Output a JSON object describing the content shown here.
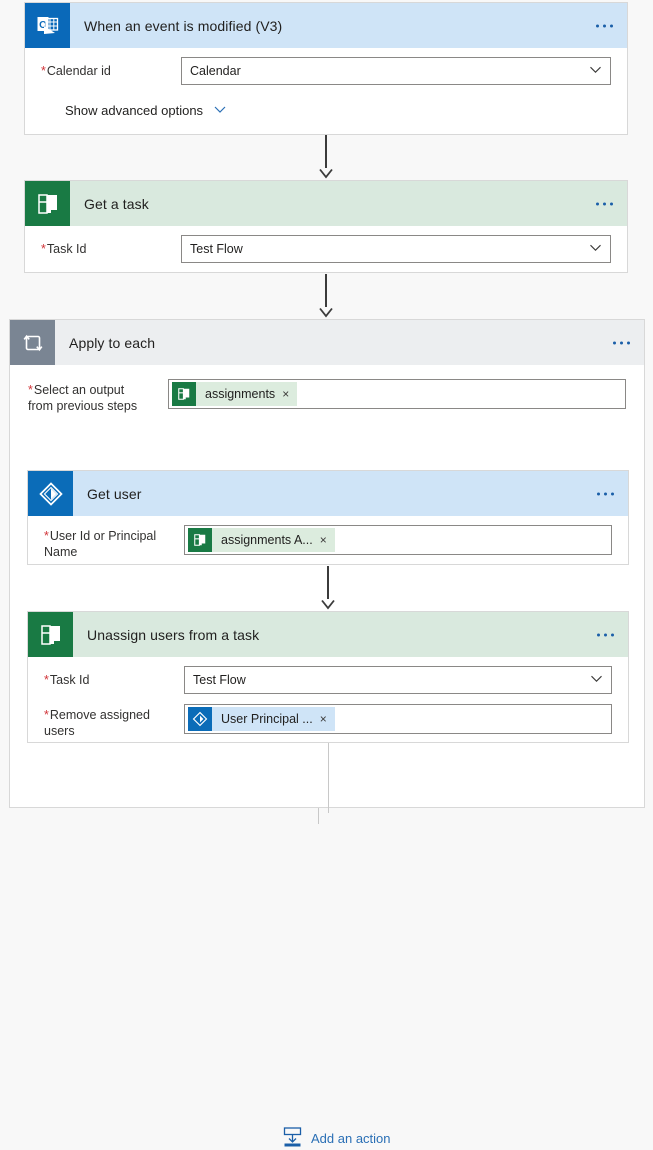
{
  "colors": {
    "canvas_bg": "#f8f8f8",
    "header_blue": "#cfe4f7",
    "header_green": "#d9e9de",
    "header_gray": "#eceef0",
    "outlook_icon_bg": "#0a69b9",
    "planner_icon_bg": "#197a44",
    "azuread_icon_bg": "#0b6cb8",
    "loop_icon_bg": "#7a8593",
    "required_asterisk": "#d13438",
    "link_blue": "#2a6fb5",
    "connector_gray": "#3b3b3b"
  },
  "steps": {
    "trigger": {
      "title": "When an event is modified (V3)",
      "icon": "outlook-icon",
      "menu": "more-commands",
      "fields": [
        {
          "label": "Calendar id",
          "required": true,
          "value": "Calendar",
          "control": "dropdown",
          "chevron": "chevron-down-icon"
        }
      ],
      "advanced": {
        "label": "Show advanced options",
        "chevron": "chevron-down-icon"
      }
    },
    "get_task": {
      "title": "Get a task",
      "icon": "planner-icon",
      "menu": "more-commands",
      "fields": [
        {
          "label": "Task Id",
          "required": true,
          "value": "Test Flow",
          "control": "dropdown",
          "chevron": "chevron-down-icon"
        }
      ]
    },
    "apply_to_each": {
      "title": "Apply to each",
      "icon": "loop-icon",
      "menu": "more-commands",
      "field": {
        "label_line1": "Select an output",
        "label_line2": "from previous steps",
        "required": true,
        "token": {
          "text": "assignments",
          "icon": "planner-icon",
          "remove": "×",
          "style": "green"
        }
      },
      "get_user": {
        "title": "Get user",
        "icon": "azure-ad-icon",
        "menu": "more-commands",
        "field": {
          "label_line1": "User Id or Principal",
          "label_line2": "Name",
          "required": true,
          "token": {
            "text": "assignments A...",
            "icon": "planner-icon",
            "remove": "×",
            "style": "green"
          }
        }
      },
      "unassign": {
        "title": "Unassign users from a task",
        "icon": "planner-icon",
        "menu": "more-commands",
        "fields": [
          {
            "label": "Task Id",
            "required": true,
            "value": "Test Flow",
            "control": "dropdown",
            "chevron": "chevron-down-icon"
          }
        ],
        "token_field": {
          "label_line1": "Remove assigned",
          "label_line2": "users",
          "required": true,
          "token": {
            "text": "User Principal ...",
            "icon": "azure-ad-icon",
            "remove": "×",
            "style": "blue"
          }
        }
      },
      "add_action": {
        "label": "Add an action",
        "icon": "add-action-icon"
      }
    }
  }
}
